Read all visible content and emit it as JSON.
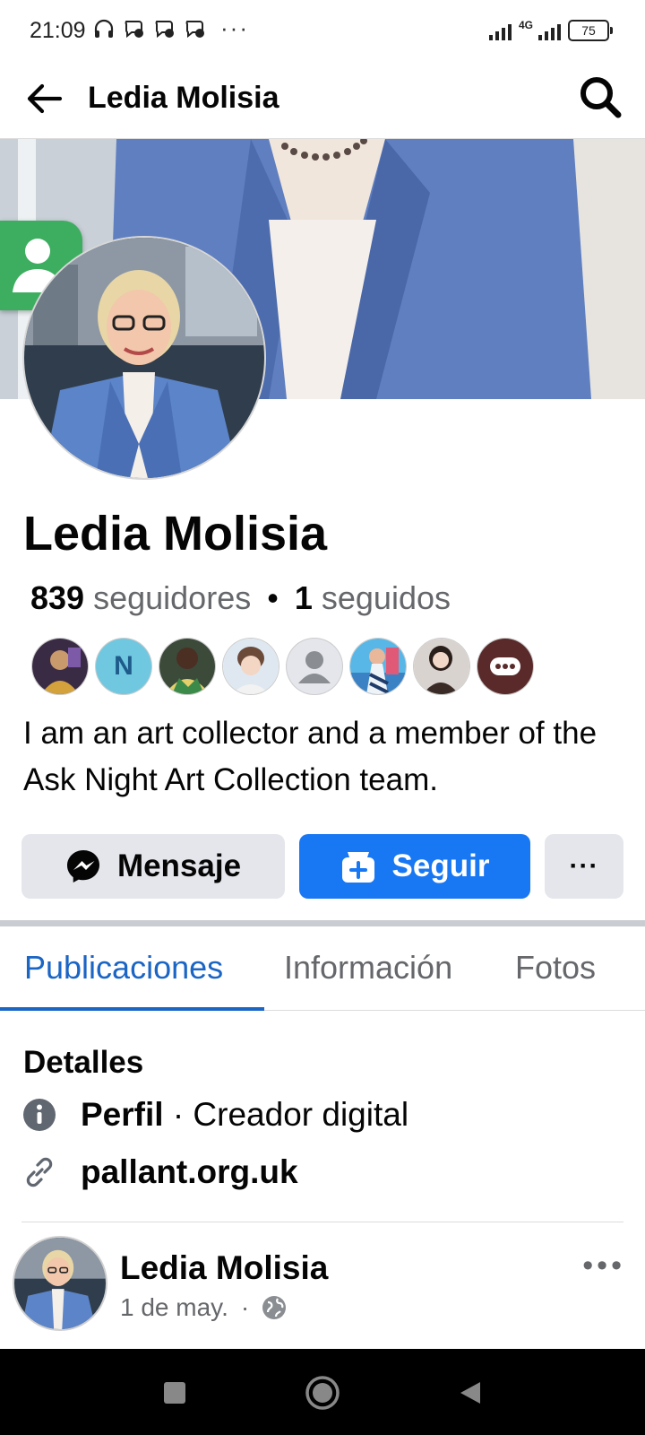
{
  "status_bar": {
    "time": "21:09",
    "network": "4G",
    "battery": "75"
  },
  "top_bar": {
    "title": "Ledia Molisia"
  },
  "profile": {
    "name": "Ledia Molisia",
    "followers_count": "839",
    "followers_label": "seguidores",
    "separator": "•",
    "following_count": "1",
    "following_label": "seguidos",
    "bio": "I am an art collector and a member of the Ask Night Art Collection team.",
    "friend_initial": "N"
  },
  "actions": {
    "message_label": "Mensaje",
    "follow_label": "Seguir",
    "more_label": "···"
  },
  "tabs": [
    {
      "label": "Publicaciones",
      "active": true
    },
    {
      "label": "Información",
      "active": false
    },
    {
      "label": "Fotos",
      "active": false
    }
  ],
  "details": {
    "title": "Detalles",
    "profile_type_bold": "Perfil",
    "profile_type_rest": " · Creador digital",
    "link": "pallant.org.uk"
  },
  "post": {
    "author": "Ledia Molisia",
    "date": "1 de may.",
    "dot": "·",
    "more": "•••"
  },
  "colors": {
    "brand_blue": "#1877f2",
    "tab_active": "#1b65c4",
    "secondary_text": "#65676b",
    "button_gray": "#e4e6eb"
  }
}
